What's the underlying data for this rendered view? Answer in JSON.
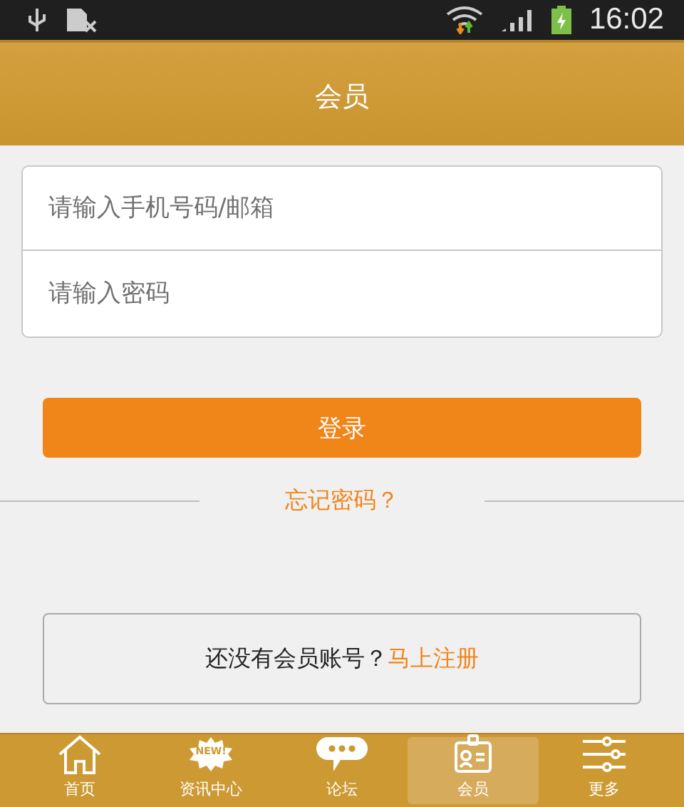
{
  "status_bar": {
    "time": "16:02"
  },
  "header": {
    "title": "会员"
  },
  "form": {
    "fields": [
      {
        "placeholder": "请输入手机号码/邮箱"
      },
      {
        "placeholder": "请输入密码"
      }
    ]
  },
  "login_button": "登录",
  "forgot_link": "忘记密码？",
  "register": {
    "text": "还没有会员账号？",
    "link": "马上注册"
  },
  "nav": [
    {
      "label": "首页",
      "kind": "home",
      "selected": false
    },
    {
      "label": "资讯中心",
      "kind": "news",
      "badge": "NEW!",
      "selected": false
    },
    {
      "label": "论坛",
      "kind": "forum",
      "selected": false
    },
    {
      "label": "会员",
      "kind": "member",
      "selected": true
    },
    {
      "label": "更多",
      "kind": "more",
      "selected": false
    }
  ]
}
